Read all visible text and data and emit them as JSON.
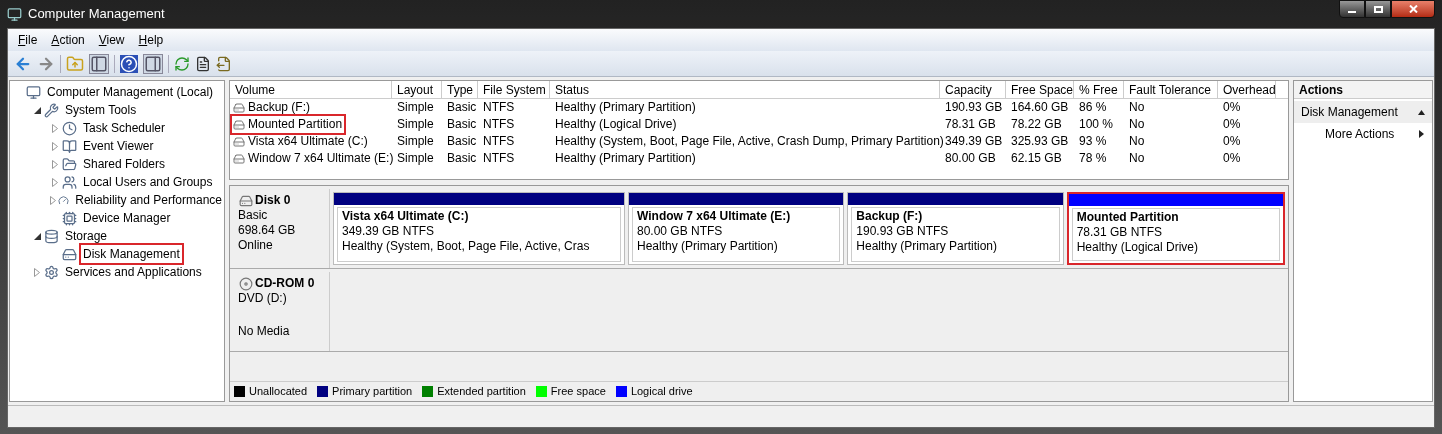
{
  "window": {
    "title": "Computer Management"
  },
  "menu": [
    "File",
    "Action",
    "View",
    "Help"
  ],
  "tree": [
    {
      "label": "Computer Management (Local)",
      "highlighted": false,
      "children": [
        {
          "label": "System Tools",
          "expanded": true,
          "highlighted": false,
          "children": [
            {
              "label": "Task Scheduler",
              "expanded": false,
              "highlighted": false
            },
            {
              "label": "Event Viewer",
              "expanded": false,
              "highlighted": false
            },
            {
              "label": "Shared Folders",
              "expanded": false,
              "highlighted": false
            },
            {
              "label": "Local Users and Groups",
              "expanded": false,
              "highlighted": false
            },
            {
              "label": "Reliability and Performance",
              "expanded": false,
              "highlighted": false
            },
            {
              "label": "Device Manager",
              "highlighted": false
            }
          ]
        },
        {
          "label": "Storage",
          "expanded": true,
          "highlighted": false,
          "children": [
            {
              "label": "Disk Management",
              "highlighted": true
            }
          ]
        },
        {
          "label": "Services and Applications",
          "expanded": false,
          "highlighted": false
        }
      ]
    }
  ],
  "table": {
    "columns": [
      "Volume",
      "Layout",
      "Type",
      "File System",
      "Status",
      "Capacity",
      "Free Space",
      "% Free",
      "Fault Tolerance",
      "Overhead"
    ],
    "rows": [
      {
        "highlighted": false,
        "cells": [
          "Backup (F:)",
          "Simple",
          "Basic",
          "NTFS",
          "Healthy (Primary Partition)",
          "190.93 GB",
          "164.60 GB",
          "86 %",
          "No",
          "0%"
        ]
      },
      {
        "highlighted": true,
        "cells": [
          "Mounted Partition",
          "Simple",
          "Basic",
          "NTFS",
          "Healthy (Logical Drive)",
          "78.31 GB",
          "78.22 GB",
          "100 %",
          "No",
          "0%"
        ]
      },
      {
        "highlighted": false,
        "cells": [
          "Vista x64 Ultimate (C:)",
          "Simple",
          "Basic",
          "NTFS",
          "Healthy (System, Boot, Page File, Active, Crash Dump, Primary Partition)",
          "349.39 GB",
          "325.93 GB",
          "93 %",
          "No",
          "0%"
        ]
      },
      {
        "highlighted": false,
        "cells": [
          "Window 7 x64 Ultimate (E:)",
          "Simple",
          "Basic",
          "NTFS",
          "Healthy (Primary Partition)",
          "80.00 GB",
          "62.15 GB",
          "78 %",
          "No",
          "0%"
        ]
      }
    ]
  },
  "disks": [
    {
      "kind": "disk",
      "name": "Disk 0",
      "type": "Basic",
      "size": "698.64 GB",
      "status": "Online",
      "partitions": [
        {
          "title": "Vista x64 Ultimate  (C:)",
          "size": "349.39 GB NTFS",
          "status": "Healthy (System, Boot, Page File, Active, Cras",
          "color": "#000080",
          "highlighted": false
        },
        {
          "title": "Window 7 x64 Ultimate  (E:)",
          "size": "80.00 GB NTFS",
          "status": "Healthy (Primary Partition)",
          "color": "#000080",
          "highlighted": false
        },
        {
          "title": "Backup  (F:)",
          "size": "190.93 GB NTFS",
          "status": "Healthy (Primary Partition)",
          "color": "#000080",
          "highlighted": false
        },
        {
          "title": "Mounted Partition",
          "size": "78.31 GB NTFS",
          "status": "Healthy (Logical Drive)",
          "color": "#0000ff",
          "highlighted": true
        }
      ]
    },
    {
      "kind": "cdrom",
      "name": "CD-ROM 0",
      "type": "DVD (D:)",
      "status": "No Media"
    }
  ],
  "legend": [
    {
      "label": "Unallocated",
      "color": "#000000"
    },
    {
      "label": "Primary partition",
      "color": "#000080"
    },
    {
      "label": "Extended partition",
      "color": "#008000"
    },
    {
      "label": "Free space",
      "color": "#00ff00"
    },
    {
      "label": "Logical drive",
      "color": "#0000ff"
    }
  ],
  "actions": {
    "title": "Actions",
    "section": "Disk Management",
    "items": [
      "More Actions"
    ]
  }
}
